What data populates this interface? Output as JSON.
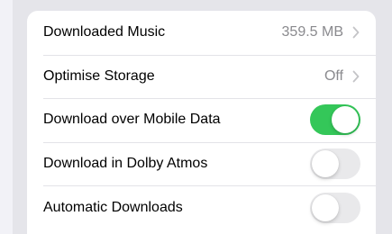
{
  "settings": {
    "rows": [
      {
        "label": "Downloaded Music",
        "value": "359.5 MB",
        "type": "disclosure"
      },
      {
        "label": "Optimise Storage",
        "value": "Off",
        "type": "disclosure"
      },
      {
        "label": "Download over Mobile Data",
        "type": "toggle",
        "on": true
      },
      {
        "label": "Download in Dolby Atmos",
        "type": "toggle",
        "on": false
      },
      {
        "label": "Automatic Downloads",
        "type": "toggle",
        "on": false
      }
    ]
  },
  "colors": {
    "toggle_on": "#34c759",
    "toggle_off": "#e9e9eb",
    "secondary_text": "#8a8a8e",
    "chevron": "#c4c4c7"
  },
  "icons": {
    "disclosure": "chevron-right-icon"
  }
}
